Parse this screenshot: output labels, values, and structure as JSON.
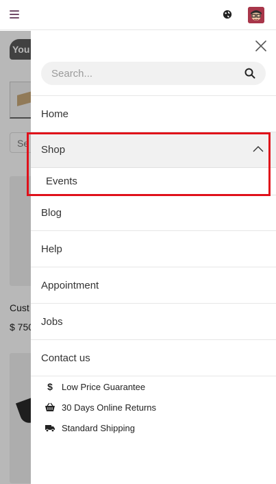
{
  "header": {
    "menu_icon": "hamburger-icon",
    "language_icon": "globe-icon",
    "avatar_icon": "user-avatar-icon",
    "accent_color": "#714B67"
  },
  "background": {
    "logo_text": "You",
    "search_fragment": "Se",
    "product_name_fragment": "Cust",
    "product_price_fragment": "$ 750"
  },
  "drawer": {
    "close_icon": "close-icon",
    "search": {
      "placeholder": "Search...",
      "value": "",
      "icon": "search-icon"
    },
    "menu": [
      {
        "label": "Home"
      },
      {
        "label": "Shop",
        "expanded": true,
        "submenu": [
          {
            "label": "Events"
          }
        ]
      },
      {
        "label": "Blog"
      },
      {
        "label": "Help"
      },
      {
        "label": "Appointment"
      },
      {
        "label": "Jobs"
      },
      {
        "label": "Contact us"
      }
    ],
    "features": [
      {
        "icon": "dollar-icon",
        "label": "Low Price Guarantee"
      },
      {
        "icon": "basket-icon",
        "label": "30 Days Online Returns"
      },
      {
        "icon": "truck-icon",
        "label": "Standard Shipping"
      }
    ]
  },
  "highlight_color": "#e0101a"
}
